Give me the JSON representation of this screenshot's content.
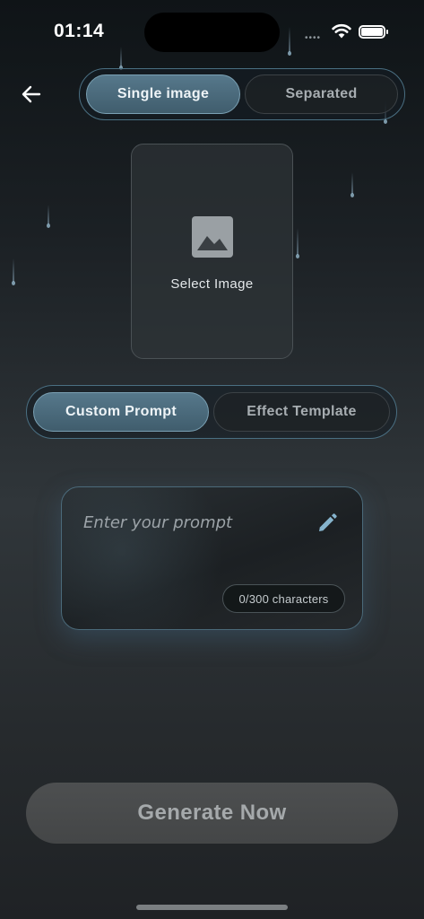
{
  "status_bar": {
    "time": "01:14",
    "signal": "••••"
  },
  "header": {
    "back_icon": "arrow-left-icon",
    "mode_toggle": {
      "selected": "Single image",
      "options": [
        "Single image",
        "Separated"
      ]
    }
  },
  "image_picker": {
    "icon": "image-icon",
    "label": "Select Image"
  },
  "prompt_toggle": {
    "selected": "Custom Prompt",
    "options": [
      "Custom Prompt",
      "Effect Template"
    ]
  },
  "prompt": {
    "value": "",
    "placeholder": "Enter your prompt",
    "edit_icon": "pencil-icon",
    "char_count": "0/300 characters"
  },
  "generate_button": {
    "label": "Generate Now"
  },
  "colors": {
    "accent": "#4f7386",
    "accent_border": "#7aa0b3",
    "edit_icon": "#86b4cd",
    "button_bg": "#4a4c4d",
    "button_text": "#a5a9ab"
  }
}
